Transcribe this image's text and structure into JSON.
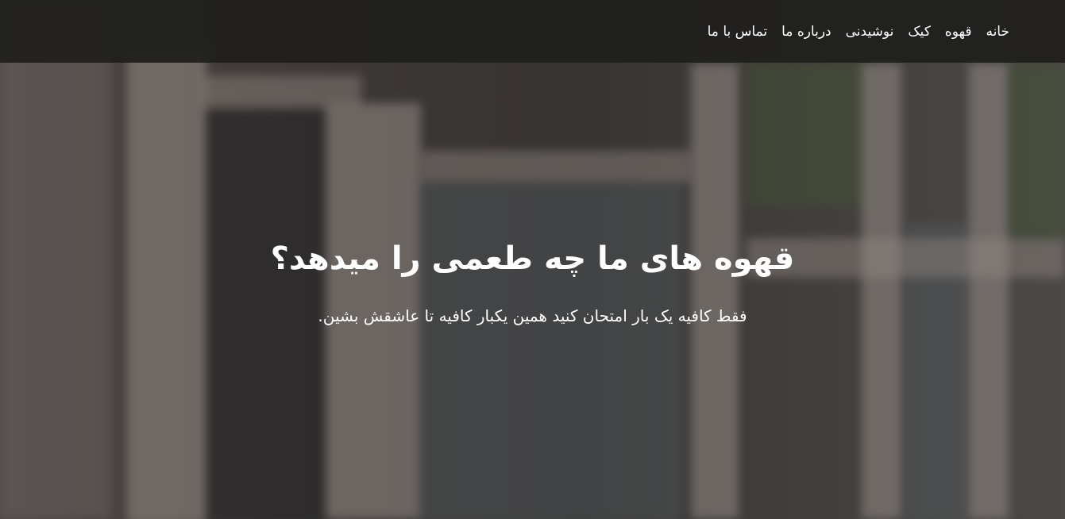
{
  "nav": {
    "items": [
      {
        "label": "خانه"
      },
      {
        "label": "قهوه"
      },
      {
        "label": "کیک"
      },
      {
        "label": "نوشیدنی"
      },
      {
        "label": "درباره ما"
      },
      {
        "label": "تماس با ما"
      }
    ]
  },
  "hero": {
    "title": "قهوه های ما چه طعمی را میدهد؟",
    "subtitle": "فقط کافیه یک بار امتحان کنید همین یکبار کافیه تا عاشقش بشین."
  },
  "colors": {
    "navbar_bg": "#1e1e1c",
    "text": "#ffffff"
  }
}
